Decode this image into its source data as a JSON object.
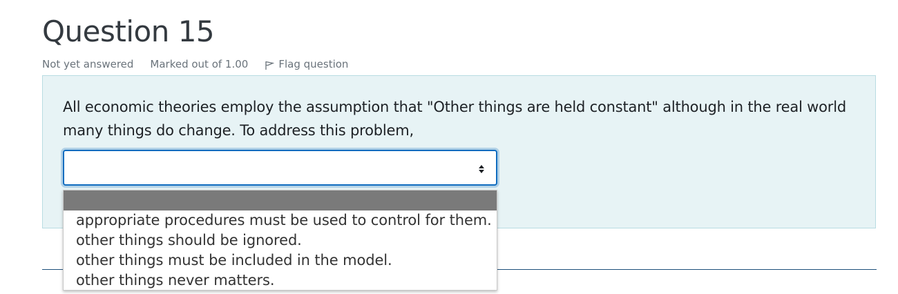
{
  "question": {
    "title": "Question 15",
    "status": "Not yet answered",
    "marks": "Marked out of 1.00",
    "flag_label": "Flag question",
    "text": "All economic theories employ the assumption that \"Other things are held constant\" although in the real world many things do change. To address this problem,",
    "select_value": "",
    "options": [
      "",
      "appropriate procedures must be used to control for them.",
      "other things should be ignored.",
      "other things must be included in the model.",
      "other things never matters."
    ]
  },
  "colors": {
    "content_bg": "#e7f3f5",
    "select_border": "#0f6cbf",
    "highlight": "#7a7a7a"
  },
  "icons": {
    "flag": "flag-icon",
    "select_arrows": "sort-icon"
  }
}
